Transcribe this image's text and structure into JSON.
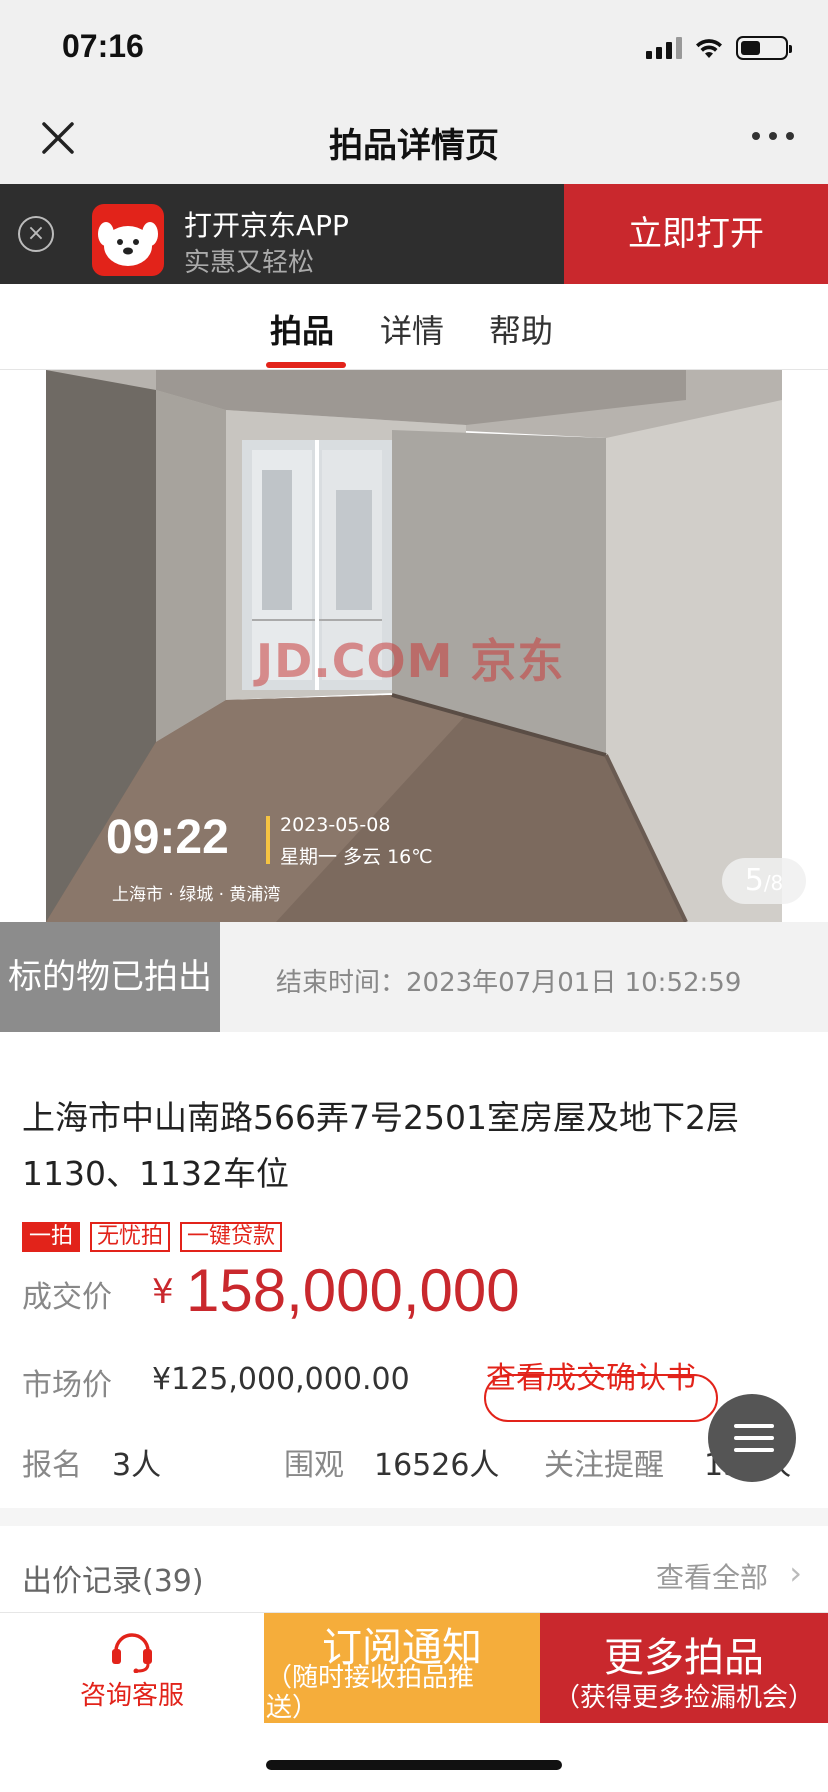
{
  "status_bar": {
    "time": "07:16"
  },
  "nav": {
    "title": "拍品详情页"
  },
  "app_banner": {
    "title": "打开京东APP",
    "subtitle": "实惠又轻松",
    "open_label": "立即打开",
    "close_glyph": "×"
  },
  "tabs": [
    {
      "label": "拍品",
      "active": true
    },
    {
      "label": "详情",
      "active": false
    },
    {
      "label": "帮助",
      "active": false
    }
  ],
  "photo": {
    "watermark": "JD.COM 京东",
    "stamp_time": "09:22",
    "stamp_date": "2023-05-08",
    "stamp_weather": "星期一  多云 16℃",
    "stamp_location": "上海市 · 绿城 · 黄浦湾",
    "current_index": "5",
    "total_label": "/8"
  },
  "auction_status": {
    "badge": "标的物已拍出",
    "end_time": "结束时间：2023年07月01日 10:52:59"
  },
  "item": {
    "title": "上海市中山南路566弄7号2501室房屋及地下2层1130、1132车位",
    "tags": [
      "一拍",
      "无忧拍",
      "一键贷款"
    ]
  },
  "price": {
    "deal_label": "成交价",
    "currency": "¥",
    "deal_value": "158,000,000",
    "market_label": "市场价",
    "market_value": "¥125,000,000.00",
    "confirm_link": "查看成交确认书"
  },
  "stats": {
    "signup_label": "报名",
    "signup_value": "3人",
    "views_label": "围观",
    "views_value": "16526人",
    "follow_label": "关注提醒",
    "follow_value": "138人"
  },
  "bids": {
    "title": "出价记录(39)",
    "view_all": "查看全部",
    "chevron": "›"
  },
  "bottom_bar": {
    "service_label": "咨询客服",
    "subscribe_main": "订阅通知",
    "subscribe_sub": "（随时接收拍品推送）",
    "more_main": "更多拍品",
    "more_sub": "（获得更多捡漏机会）"
  },
  "colors": {
    "accent_red": "#e2231a",
    "banner_red": "#c9282d",
    "subscribe_orange": "#f5ad3b",
    "sold_gray": "#8c8c8c"
  },
  "icons": [
    "close-icon",
    "more-icon",
    "jd-logo-icon",
    "headset-icon",
    "menu-icon",
    "chevron-right-icon",
    "signal-icon",
    "wifi-icon",
    "battery-icon"
  ]
}
